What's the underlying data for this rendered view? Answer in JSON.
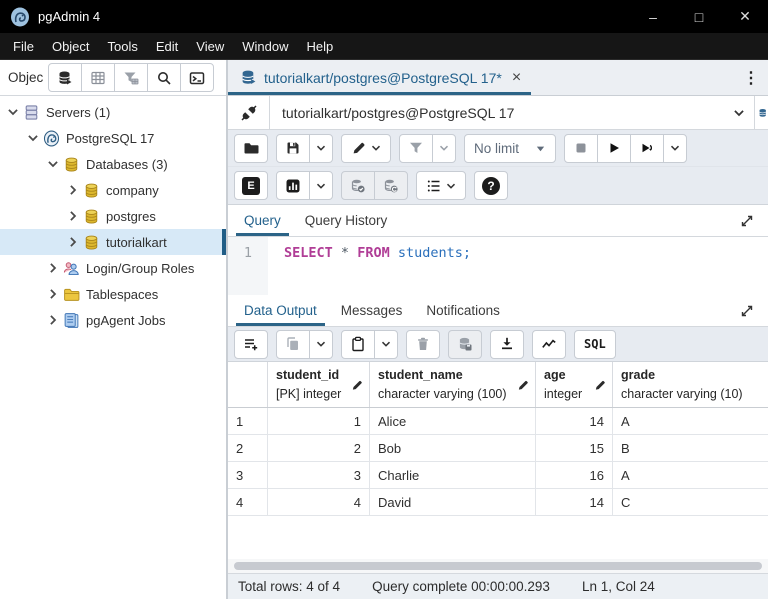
{
  "titlebar": {
    "app_title": "pgAdmin 4",
    "minimize_glyph": "–",
    "maximize_glyph": "□",
    "close_glyph": "✕"
  },
  "menubar": {
    "items": [
      "File",
      "Object",
      "Tools",
      "Edit",
      "View",
      "Window",
      "Help"
    ]
  },
  "object_explorer": {
    "label": "Objec"
  },
  "tree": {
    "items": [
      {
        "label": "Servers (1)",
        "icon": "server-stack",
        "expanded": true
      },
      {
        "label": "PostgreSQL 17",
        "icon": "postgresql-elephant",
        "expanded": true
      },
      {
        "label": "Databases (3)",
        "icon": "database-yellow",
        "expanded": true
      },
      {
        "label": "company",
        "icon": "database-yellow",
        "expanded": false
      },
      {
        "label": "postgres",
        "icon": "database-yellow",
        "expanded": false
      },
      {
        "label": "tutorialkart",
        "icon": "database-yellow",
        "expanded": false,
        "selected": true
      },
      {
        "label": "Login/Group Roles",
        "icon": "roles",
        "expanded": false
      },
      {
        "label": "Tablespaces",
        "icon": "folder-yellow",
        "expanded": false
      },
      {
        "label": "pgAgent Jobs",
        "icon": "clipboard-blue",
        "expanded": false
      }
    ]
  },
  "editor_tab": {
    "title": "tutorialkart/postgres@PostgreSQL 17*",
    "close_glyph": "×",
    "kebab_glyph": "⋮"
  },
  "connection": {
    "label": "tutorialkart/postgres@PostgreSQL 17"
  },
  "query_toolbar": {
    "limit": "No limit",
    "explain_glyph": "E",
    "help_glyph": "?"
  },
  "editor_tabs": {
    "query": "Query",
    "history": "Query History"
  },
  "sql": {
    "line_number": "1",
    "kw_select": "SELECT",
    "star": "*",
    "kw_from": "FROM",
    "identifier": "students;"
  },
  "output_tabs": {
    "data_output": "Data Output",
    "messages": "Messages",
    "notifications": "Notifications"
  },
  "output_toolbar": {
    "sql_button": "SQL"
  },
  "grid": {
    "columns": [
      {
        "name": "student_id",
        "type": "[PK] integer"
      },
      {
        "name": "student_name",
        "type": "character varying (100)"
      },
      {
        "name": "age",
        "type": "integer"
      },
      {
        "name": "grade",
        "type": "character varying (10)"
      }
    ],
    "rows": [
      {
        "num": "1",
        "student_id": "1",
        "student_name": "Alice",
        "age": "14",
        "grade": "A"
      },
      {
        "num": "2",
        "student_id": "2",
        "student_name": "Bob",
        "age": "15",
        "grade": "B"
      },
      {
        "num": "3",
        "student_id": "3",
        "student_name": "Charlie",
        "age": "16",
        "grade": "A"
      },
      {
        "num": "4",
        "student_id": "4",
        "student_name": "David",
        "age": "14",
        "grade": "C"
      }
    ]
  },
  "statusbar": {
    "total_rows": "Total rows: 4 of 4",
    "query_status": "Query complete 00:00:00.293",
    "cursor_position": "Ln 1, Col 24"
  },
  "colors": {
    "accent": "#2c6487",
    "keyword": "#b03d96",
    "identifier": "#2a6fbb",
    "tree_selected_bg": "#d7e9f7",
    "titlebar_bg": "#000000"
  }
}
